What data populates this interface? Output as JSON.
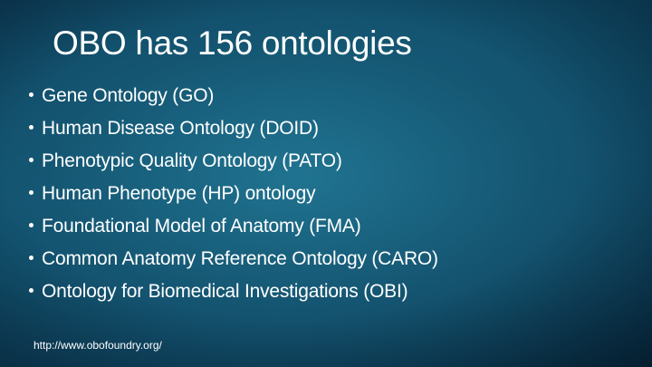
{
  "slide": {
    "title": "OBO has 156 ontologies",
    "bullets": [
      "Gene Ontology (GO)",
      "Human Disease Ontology (DOID)",
      "Phenotypic Quality Ontology (PATO)",
      "Human Phenotype (HP) ontology",
      "Foundational Model of Anatomy (FMA)",
      "Common Anatomy Reference Ontology (CARO)",
      "Ontology for Biomedical Investigations (OBI)"
    ],
    "footer_link": "http://www.obofoundry.org/"
  },
  "colors": {
    "background_dark": "#0c3a56",
    "background_light": "#217693",
    "text": "#ffffff"
  }
}
